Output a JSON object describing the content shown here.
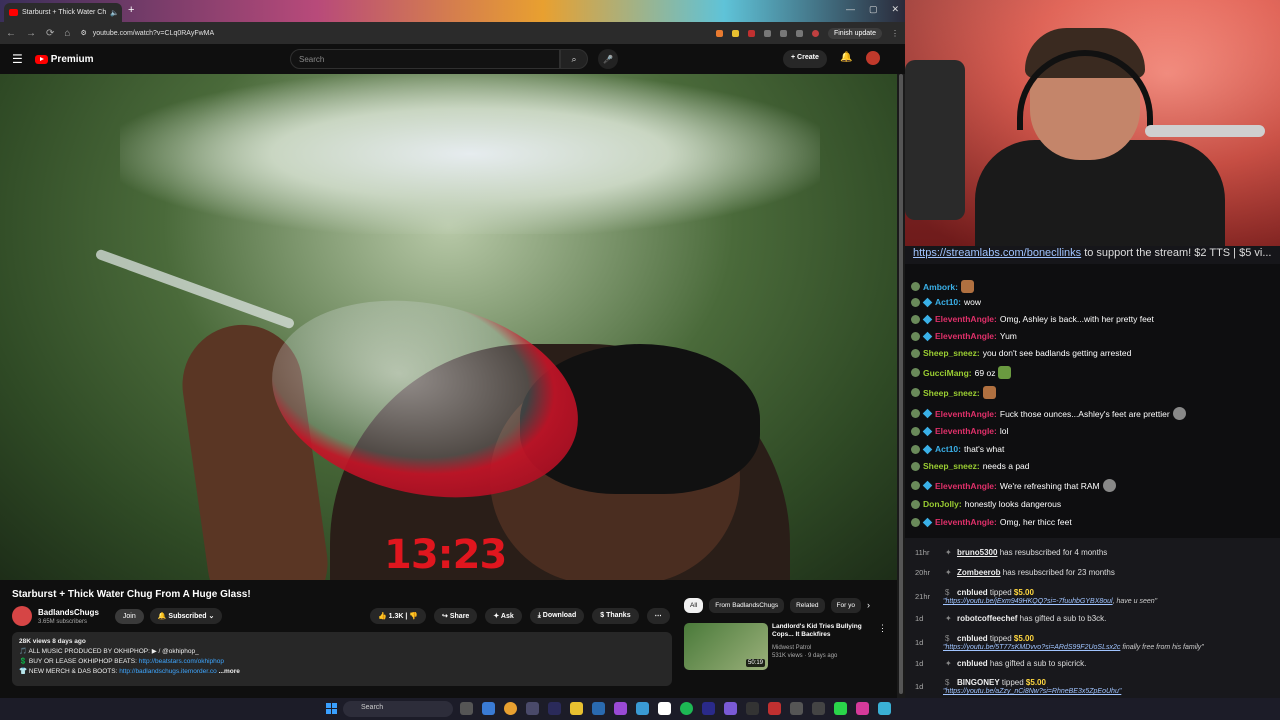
{
  "browser": {
    "tab_title": "Starburst + Thick Water Ch",
    "url": "youtube.com/watch?v=CLq0RAyFwMA",
    "finish_update": "Finish update"
  },
  "youtube": {
    "logo": "Premium",
    "search_placeholder": "Search",
    "create": "Create",
    "video_timer": "13:23",
    "video_title": "Starburst + Thick Water Chug From A Huge Glass!",
    "channel_name": "BadlandsChugs",
    "channel_subs": "3.65M subscribers",
    "join": "Join",
    "subscribed": "Subscribed",
    "likes": "1.3K",
    "share": "Share",
    "ask": "Ask",
    "download": "Download",
    "thanks": "Thanks",
    "desc_meta": "28K views  8 days ago",
    "desc_line1": "🎵 ALL MUSIC PRODUCED BY OKHIPHOP: ▶ / @okhiphop_",
    "desc_line2_prefix": "💲 BUY OR LEASE OKHIPHOP BEATS: ",
    "desc_line2_link": "http://beatstars.com/okhiphop",
    "desc_line3_prefix": "👕 NEW MERCH & DAS BOOTS: ",
    "desc_line3_link": "http://badlandschugs.itemorder.co",
    "desc_more": "...more",
    "chips": [
      "All",
      "From BadlandsChugs",
      "Related",
      "For yo"
    ],
    "rec_title": "Landlord's Kid Tries Bullying Cops... It Backfires",
    "rec_channel": "Midwest Patrol",
    "rec_meta": "531K views · 9 days ago",
    "rec_duration": "50:19"
  },
  "taskbar": {
    "search": "Search"
  },
  "chat": {
    "banner_link": "https://streamlabs.com/bonecllinks",
    "banner_text": " to support the stream! $2 TTS | $5 vi...",
    "messages": [
      {
        "user": "Ambork:",
        "text": "",
        "color": "#3ab0e8"
      },
      {
        "user": "Act10:",
        "text": "wow",
        "color": "#3ab0e8"
      },
      {
        "user": "EleventhAngle:",
        "text": "Omg, Ashley is back...with her pretty feet",
        "color": "#e0306a"
      },
      {
        "user": "EleventhAngle:",
        "text": "Yum",
        "color": "#e0306a"
      },
      {
        "user": "Sheep_sneez:",
        "text": "you don't see badlands getting arrested",
        "color": "#9acd32"
      },
      {
        "user": "GucciMang:",
        "text": "69 oz",
        "color": "#9acd32"
      },
      {
        "user": "Sheep_sneez:",
        "text": "",
        "color": "#9acd32"
      },
      {
        "user": "EleventhAngle:",
        "text": "Fuck those ounces...Ashley's feet are prettier",
        "color": "#e0306a"
      },
      {
        "user": "EleventhAngle:",
        "text": "lol",
        "color": "#e0306a"
      },
      {
        "user": "Act10:",
        "text": "that's what",
        "color": "#3ab0e8"
      },
      {
        "user": "Sheep_sneez:",
        "text": "needs a pad",
        "color": "#9acd32"
      },
      {
        "user": "EleventhAngle:",
        "text": "We're refreshing that RAM",
        "color": "#e0306a"
      },
      {
        "user": "DonJolly:",
        "text": "honestly looks dangerous",
        "color": "#9acd32"
      },
      {
        "user": "EleventhAngle:",
        "text": "Omg, her thicc feet",
        "color": "#e0306a"
      }
    ],
    "events": [
      {
        "time": "11hr",
        "name": "bruno5300",
        "text": " has resubscribed for 4 months"
      },
      {
        "time": "20hr",
        "name": "Zombeerob",
        "text": " has resubscribed for 23 months"
      },
      {
        "time": "21hr",
        "name": "cnblued",
        "text": " tipped ",
        "amount": "$5.00",
        "link": "\"https://youtu.be/jExm949HKQQ?si=-7fuuhbGYBX8oul",
        "note": ", have u seen\""
      },
      {
        "time": "1d",
        "name": "robotcoffeechef",
        "text": " has gifted a sub to b3ck."
      },
      {
        "time": "1d",
        "name": "cnblued",
        "text": " tipped ",
        "amount": "$5.00",
        "link": "\"https://youtu.be/5T77sKMDvvo?si=ARdS99F2UoSLsx2c",
        "note": " finally free from his family\""
      },
      {
        "time": "1d",
        "name": "cnblued",
        "text": " has gifted a sub to spicrick."
      },
      {
        "time": "1d",
        "name": "BINGONEY",
        "text": " tipped ",
        "amount": "$5.00",
        "link": "\"https://youtu.be/aZzy_nCi8Nw?si=RhneBE3x5ZpEoUhu\"",
        "note": ""
      }
    ]
  }
}
